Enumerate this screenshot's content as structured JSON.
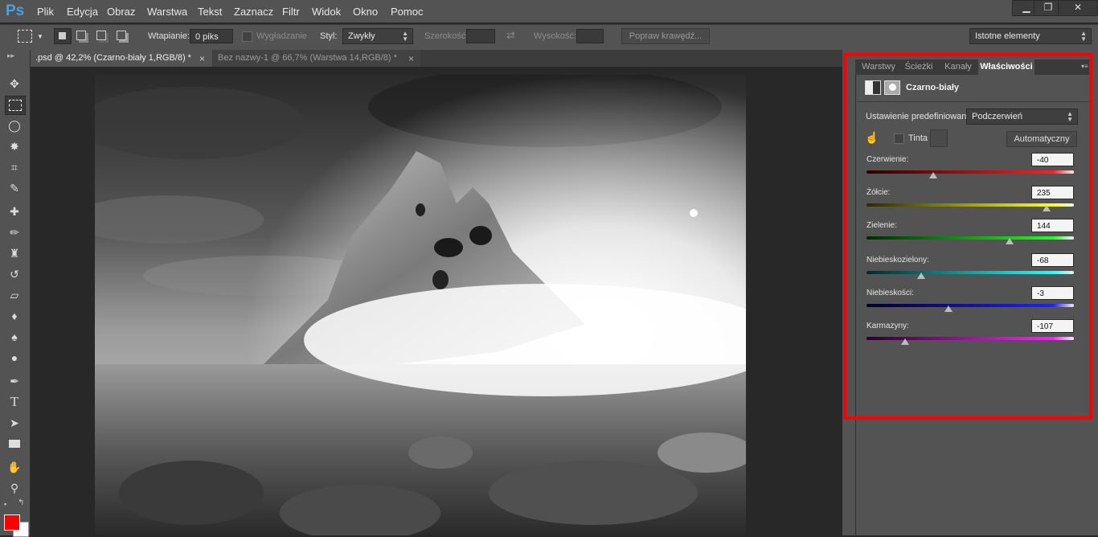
{
  "app": {
    "logo": "Ps"
  },
  "menu": [
    "Plik",
    "Edycja",
    "Obraz",
    "Warstwa",
    "Tekst",
    "Zaznacz",
    "Filtr",
    "Widok",
    "Okno",
    "Pomoc"
  ],
  "window_controls": {
    "minimize": "▁",
    "restore": "❐",
    "close": "✕"
  },
  "options_bar": {
    "feather_label": "Wtapianie:",
    "feather_value": "0 piks",
    "antialias_label": "Wygładzanie",
    "style_label": "Styl:",
    "style_value": "Zwykły",
    "width_label": "Szerokość:",
    "height_label": "Wysokość:",
    "refine_edge_label": "Popraw krawędź...",
    "workspace_value": "Istotne elementy"
  },
  "tabs": [
    {
      "label": ".psd @ 42,2% (Czarno-biały 1,RGB/8) *",
      "close": "×"
    },
    {
      "label": "Bez nazwy-1 @ 66,7% (Warstwa 14,RGB/8) *",
      "close": "×"
    }
  ],
  "panel": {
    "tabs": [
      "Warstwy",
      "Ścieżki",
      "Kanały",
      "Właściwości"
    ],
    "title": "Czarno-biały",
    "preset_label": "Ustawienie predefiniowane:",
    "preset_value": "Podczerwień",
    "tint_label": "Tinta",
    "auto_button": "Automatyczny",
    "sliders": [
      {
        "label": "Czerwienie:",
        "value": "-40",
        "num": -40,
        "gradient": [
          "#2a0000",
          "#ff2020"
        ]
      },
      {
        "label": "Żółcie:",
        "value": "235",
        "num": 235,
        "gradient": [
          "#2a2a00",
          "#ffff20"
        ]
      },
      {
        "label": "Zielenie:",
        "value": "144",
        "num": 144,
        "gradient": [
          "#002a00",
          "#20ff20"
        ]
      },
      {
        "label": "Niebieskozielony:",
        "value": "-68",
        "num": -68,
        "gradient": [
          "#002a2a",
          "#20ffff"
        ]
      },
      {
        "label": "Niebieskości:",
        "value": "-3",
        "num": -3,
        "gradient": [
          "#00002a",
          "#2020ff"
        ]
      },
      {
        "label": "Karmazyny:",
        "value": "-107",
        "num": -107,
        "gradient": [
          "#2a002a",
          "#ff20ff"
        ]
      }
    ],
    "slider_range": [
      -200,
      300
    ]
  },
  "colors": {
    "foreground": "#ff0000",
    "background": "#ffffff",
    "highlight": "#ff0000",
    "logo": "#4da0e0"
  }
}
